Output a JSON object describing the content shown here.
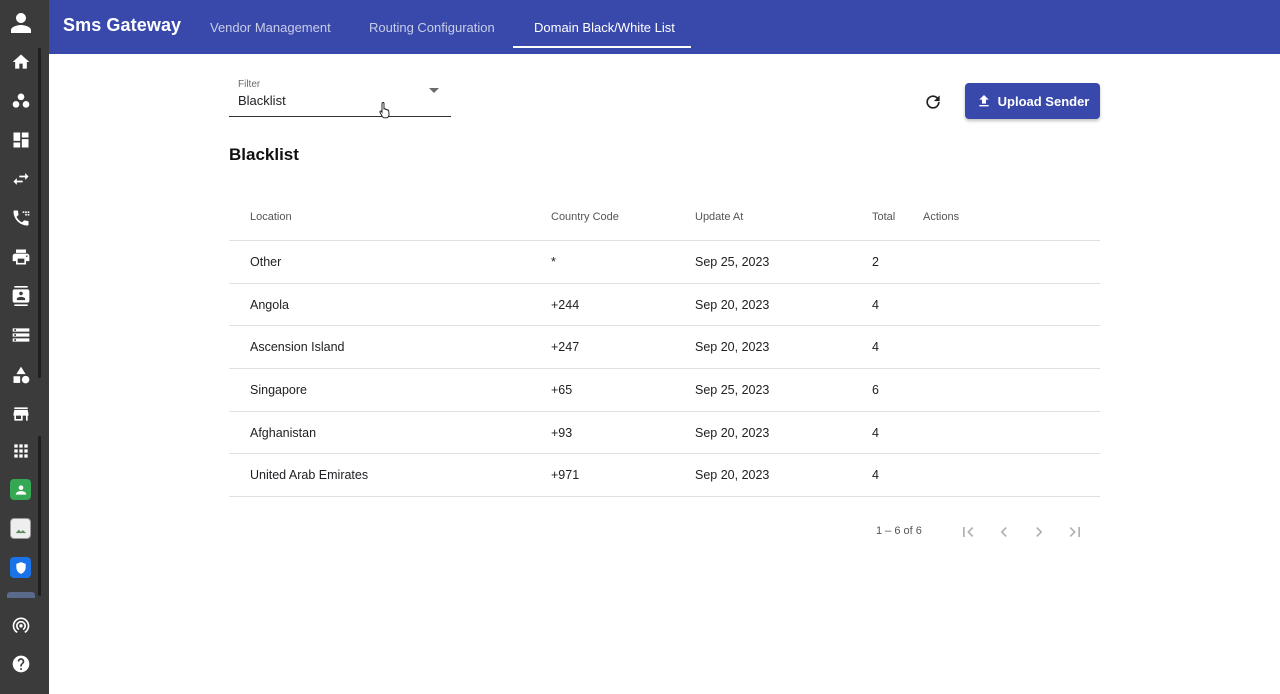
{
  "app": {
    "title": "Sms Gateway",
    "tabs": [
      {
        "label": "Vendor Management"
      },
      {
        "label": "Routing Configuration"
      },
      {
        "label": "Domain Black/White List"
      }
    ],
    "active_tab": "Domain Black/White List",
    "accent_color": "#3949ab"
  },
  "rail": {
    "icons": [
      "account-icon",
      "home-icon",
      "groups-icon",
      "dashboard-icon",
      "swap-icon",
      "phone-forward-icon",
      "printer-icon",
      "contact-card-icon",
      "storage-icon",
      "shapes-icon",
      "store-icon",
      "apps-grid-icon",
      "green-app-icon",
      "broken-image-icon",
      "shield-app-icon",
      "podcast-icon",
      "help-icon"
    ]
  },
  "filter": {
    "label": "Filter",
    "value": "Blacklist"
  },
  "toolbar": {
    "upload_label": "Upload Sender"
  },
  "section_title": "Blacklist",
  "table": {
    "headers": {
      "location": "Location",
      "country_code": "Country Code",
      "update_at": "Update At",
      "total": "Total",
      "actions": "Actions"
    },
    "rows": [
      {
        "location": "Other",
        "country_code": "*",
        "update_at": "Sep 25, 2023",
        "total": "2"
      },
      {
        "location": "Angola",
        "country_code": "+244",
        "update_at": "Sep 20, 2023",
        "total": "4"
      },
      {
        "location": "Ascension Island",
        "country_code": "+247",
        "update_at": "Sep 20, 2023",
        "total": "4"
      },
      {
        "location": "Singapore",
        "country_code": "+65",
        "update_at": "Sep 25, 2023",
        "total": "6"
      },
      {
        "location": "Afghanistan",
        "country_code": "+93",
        "update_at": "Sep 20, 2023",
        "total": "4"
      },
      {
        "location": "United Arab Emirates",
        "country_code": "+971",
        "update_at": "Sep 20, 2023",
        "total": "4"
      }
    ]
  },
  "pagination": {
    "range_label": "1 – 6 of 6"
  }
}
